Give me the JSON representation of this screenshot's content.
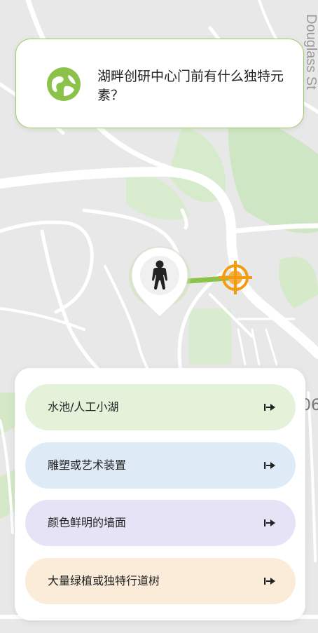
{
  "question": {
    "text": "湖畔创研中心门前有什么独特元素？",
    "icon": "map-pin-globe-icon",
    "accent_color": "#8bc34a"
  },
  "answers": [
    {
      "label": "水池/人工小湖",
      "bg_color": "#e4f2da",
      "icon": "arrow-right-icon"
    },
    {
      "label": "雕塑或艺术装置",
      "bg_color": "#deebf7",
      "icon": "arrow-right-icon"
    },
    {
      "label": "颜色鲜明的墙面",
      "bg_color": "#e6e3f6",
      "icon": "arrow-right-icon"
    },
    {
      "label": "大量绿植或独特行道树",
      "bg_color": "#fbecda",
      "icon": "arrow-right-icon"
    }
  ],
  "map": {
    "street_label": "Douglass St",
    "edge_label": "06",
    "route_color": "#8bc34a",
    "target_color": "#f39c12",
    "user_marker_icon": "person-icon",
    "target_marker_icon": "crosshair-target-icon"
  }
}
